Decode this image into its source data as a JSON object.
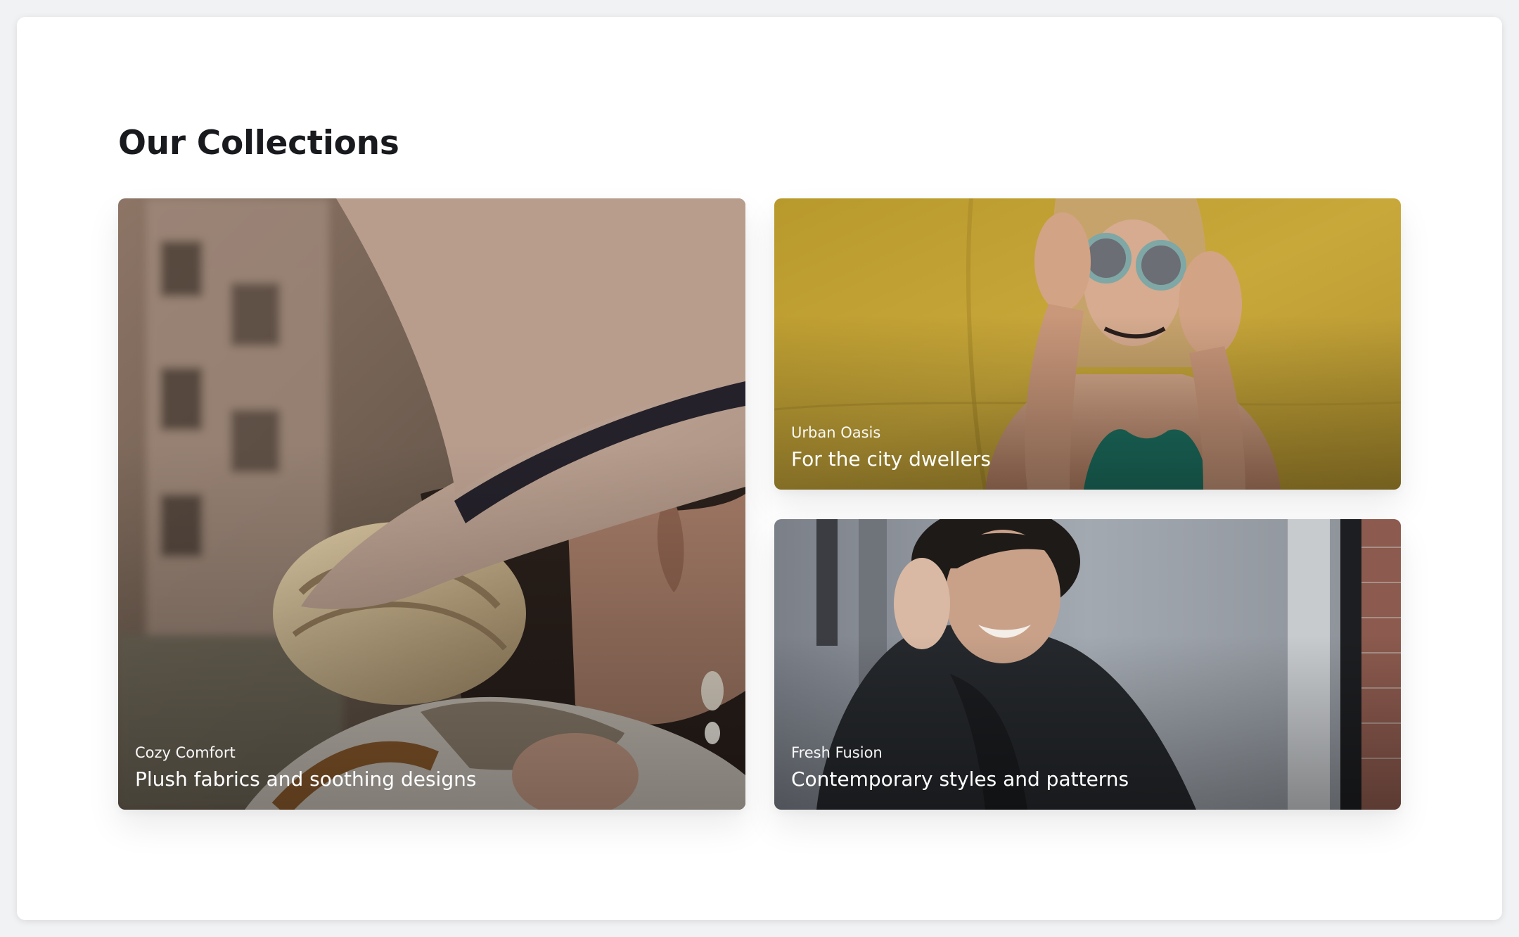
{
  "section": {
    "title": "Our Collections"
  },
  "collections": [
    {
      "name": "Cozy Comfort",
      "description": "Plush fabrics and soothing designs",
      "image": "woman-in-felt-hat-photo"
    },
    {
      "name": "Urban Oasis",
      "description": "For the city dwellers",
      "image": "woman-with-round-sunglasses-photo"
    },
    {
      "name": "Fresh Fusion",
      "description": "Contemporary styles and patterns",
      "image": "laughing-man-in-black-coat-photo"
    }
  ],
  "colors": {
    "page_background": "#f1f2f4",
    "panel_background": "#ffffff",
    "title_text": "#181a1d",
    "overlay_text": "#ffffff"
  }
}
